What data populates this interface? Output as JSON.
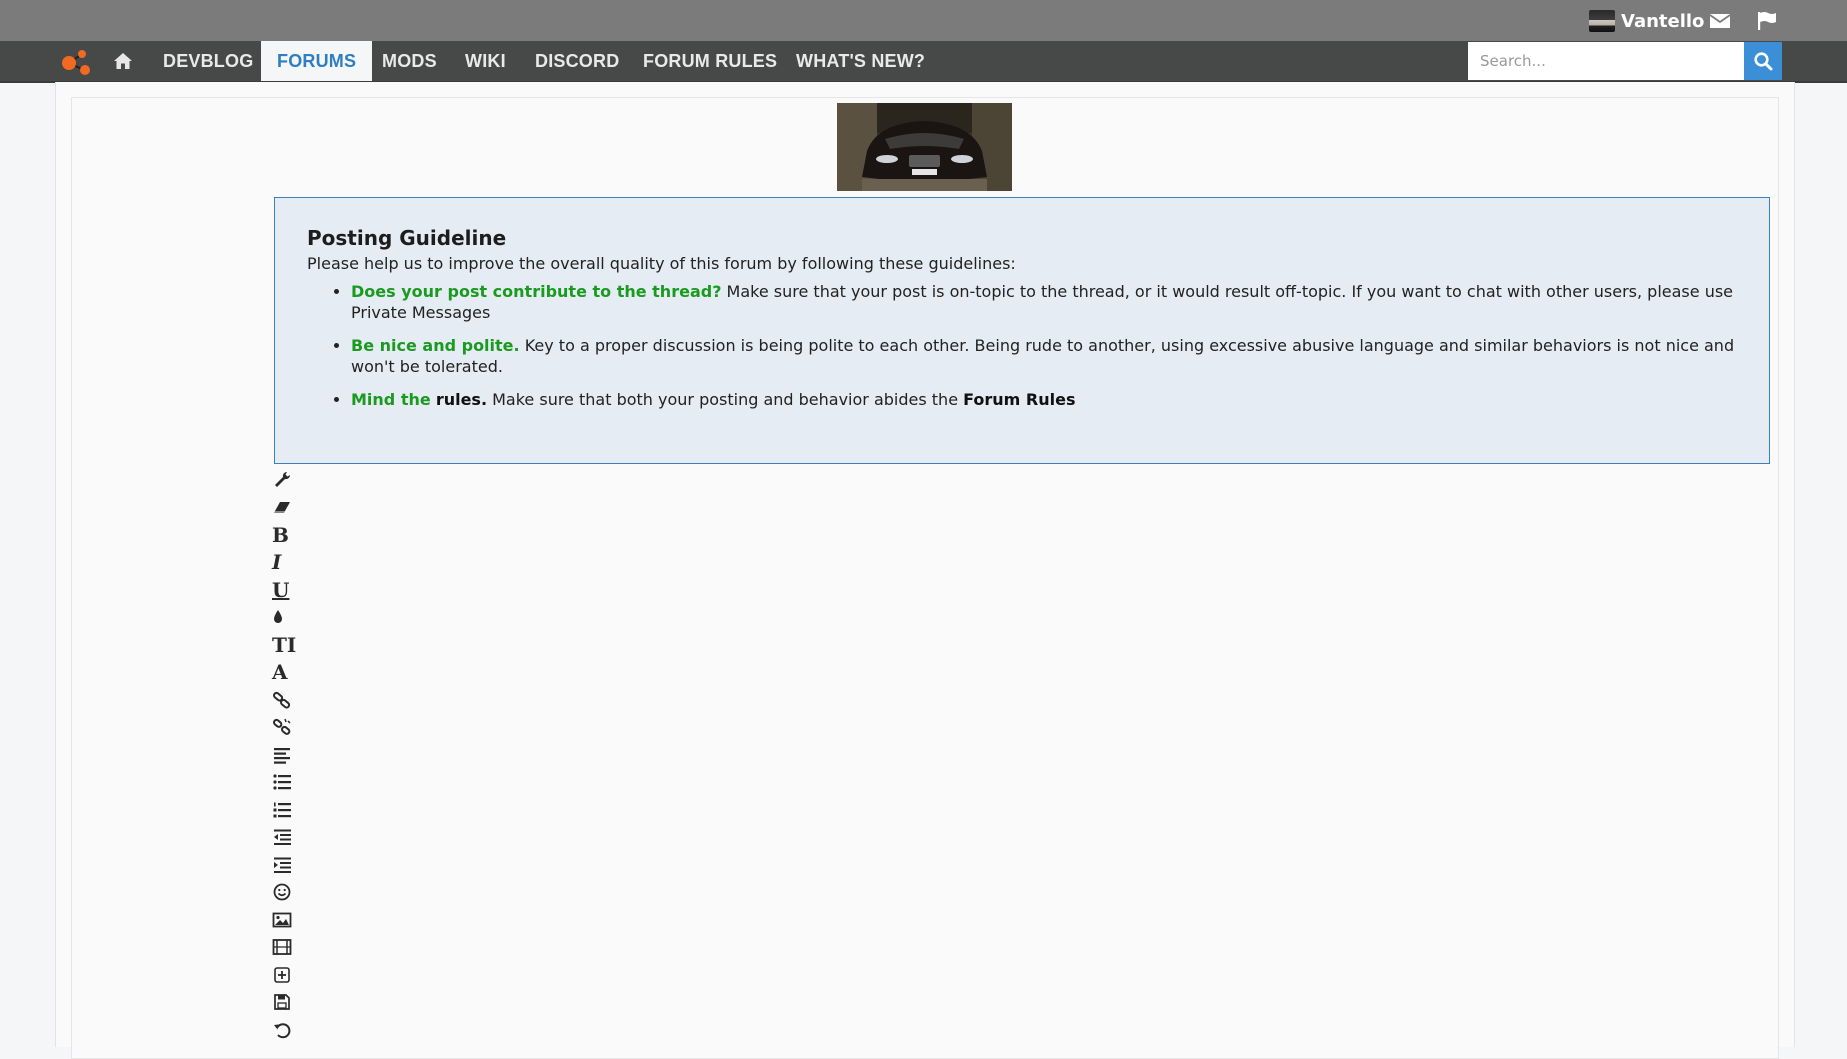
{
  "user": {
    "name": "Vantello"
  },
  "icons": {
    "mail": "envelope-icon",
    "flag": "flag-icon",
    "home": "home-icon",
    "search": "search-icon",
    "logo": "site-logo"
  },
  "nav": {
    "items": [
      {
        "label": "DEVBLOG",
        "active": false
      },
      {
        "label": "FORUMS",
        "active": true
      },
      {
        "label": "MODS",
        "active": false
      },
      {
        "label": "WIKI",
        "active": false
      },
      {
        "label": "DISCORD",
        "active": false
      },
      {
        "label": "FORUM RULES",
        "active": false
      },
      {
        "label": "WHAT'S NEW?",
        "active": false
      }
    ]
  },
  "search": {
    "placeholder": "Search...",
    "value": ""
  },
  "guideline": {
    "title": "Posting Guideline",
    "intro": "Please help us to improve the overall quality of this forum by following these guidelines:",
    "items": [
      {
        "highlight": "Does your post contribute to the thread?",
        "text": " Make sure that your post is on-topic to the thread, or it would result off-topic. If you want to chat with other users, please use Private Messages"
      },
      {
        "highlight": "Be nice and polite.",
        "text": " Key to a proper discussion is being polite to each other. Being rude to another, using excessive abusive language and similar behaviors is not nice and won't be tolerated."
      },
      {
        "highlight": "Mind the",
        "bold": "rules.",
        "text": " Make sure that both your posting and behavior abides the ",
        "link": "Forum Rules"
      }
    ]
  },
  "toolbar": {
    "bold": "B",
    "italic": "I",
    "underline": "U",
    "font_size": "TI",
    "font": "A",
    "buttons": [
      "wrench-icon",
      "eraser-icon",
      "bold-icon",
      "italic-icon",
      "underline-icon",
      "color-drop-icon",
      "font-size-icon",
      "font-icon",
      "link-icon",
      "unlink-icon",
      "align-icon",
      "bullet-list-icon",
      "numbered-list-icon",
      "outdent-icon",
      "indent-icon",
      "smiley-icon",
      "image-icon",
      "media-icon",
      "insert-icon",
      "save-icon",
      "undo-icon"
    ]
  },
  "colors": {
    "topbar": "#7b7b7b",
    "nav": "#474949",
    "active_tab_text": "#2d7ec2",
    "guideline_bg": "#e5ecf3",
    "guideline_border": "#3d7fb8",
    "highlight_green": "#1a9a1f",
    "search_button": "#3a8fd6"
  }
}
